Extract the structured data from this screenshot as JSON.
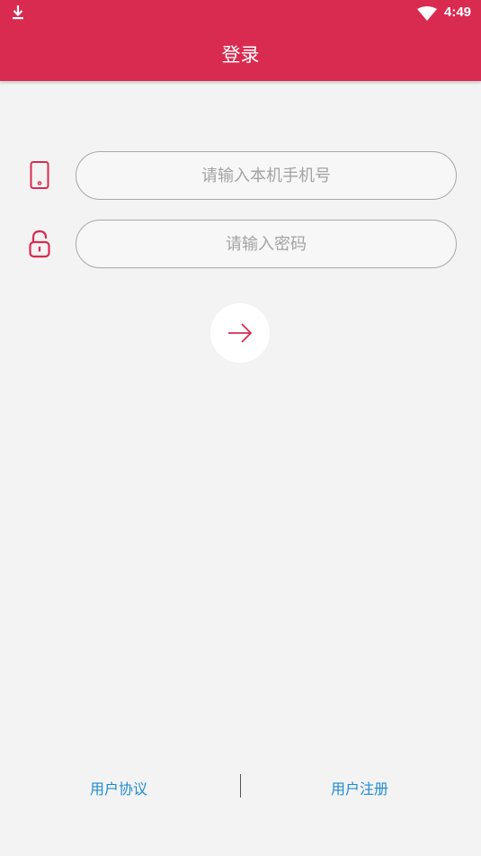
{
  "status_bar": {
    "time": "4:49"
  },
  "app_bar": {
    "title": "登录"
  },
  "form": {
    "phone_placeholder": "请输入本机手机号",
    "password_placeholder": "请输入密码"
  },
  "footer": {
    "agreement_label": "用户协议",
    "register_label": "用户注册"
  },
  "colors": {
    "accent": "#d92b50",
    "link": "#1f8bd0",
    "background": "#f3f3f3"
  }
}
